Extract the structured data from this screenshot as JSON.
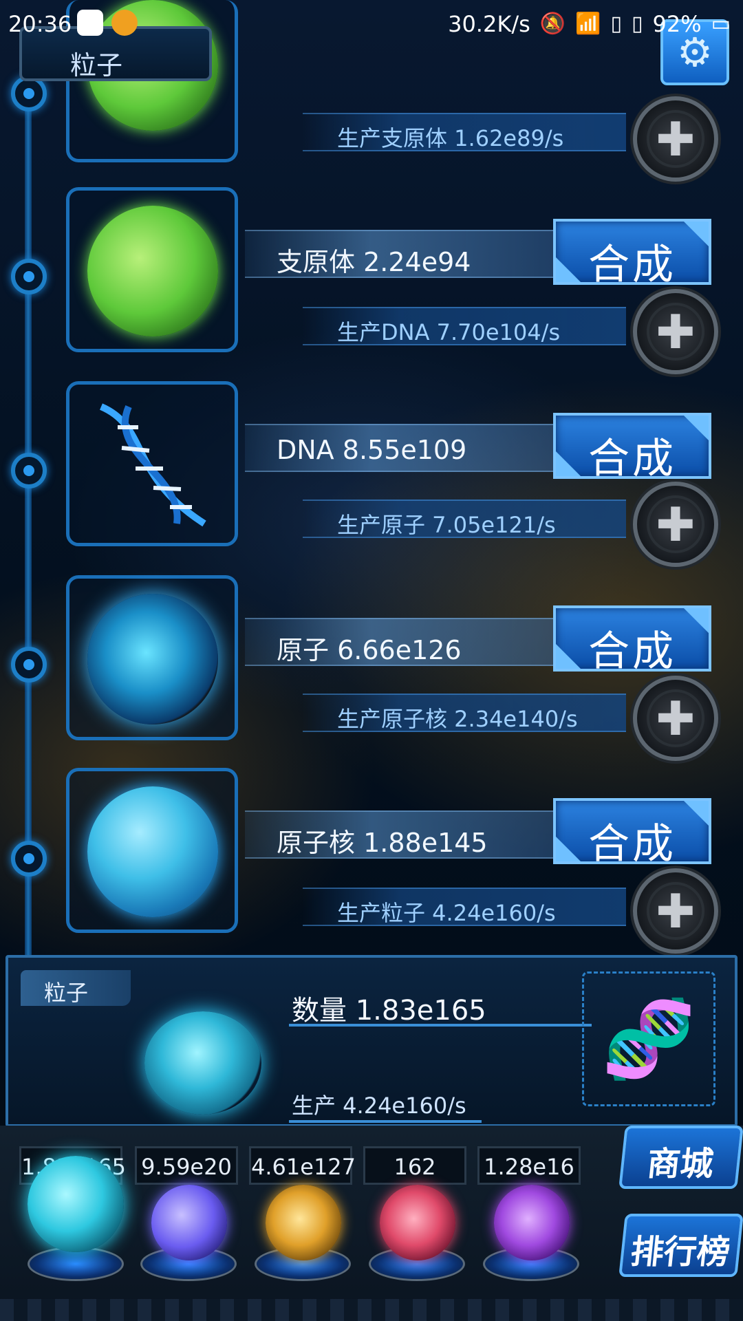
{
  "status_bar": {
    "time": "20:36",
    "speed": "30.2K/s",
    "battery": "92%",
    "icons": [
      "qq-icon",
      "app-icon",
      "mute-bell-icon",
      "wifi-icon",
      "sim-icon",
      "sim-icon",
      "battery-icon"
    ]
  },
  "header": {
    "title": "粒子",
    "settings_icon": "gear-icon"
  },
  "rows": [
    {
      "produce": "生产支原体 1.62e89/s"
    },
    {
      "name": "支原体 2.24e94",
      "synth": "合成",
      "produce": "生产DNA 7.70e104/s",
      "image": "mycoplasma-icon"
    },
    {
      "name": "DNA 8.55e109",
      "synth": "合成",
      "produce": "生产原子 7.05e121/s",
      "image": "dna-icon"
    },
    {
      "name": "原子 6.66e126",
      "synth": "合成",
      "produce": "生产原子核 2.34e140/s",
      "image": "atom-icon"
    },
    {
      "name": "原子核 1.88e145",
      "synth": "合成",
      "produce": "生产粒子 4.24e160/s",
      "image": "nucleus-icon"
    }
  ],
  "panel": {
    "tag": "粒子",
    "quantity": "数量 1.83e165",
    "production": "生产 4.24e160/s"
  },
  "resources": [
    {
      "value": "1.83e165",
      "icon": "particle-sphere-icon",
      "color": "#33c8e0"
    },
    {
      "value": "9.59e20",
      "icon": "lightning-sphere-icon",
      "color": "#7a6cff"
    },
    {
      "value": "4.61e127",
      "icon": "galaxy-sphere-icon",
      "color": "#e0a02a"
    },
    {
      "value": "162",
      "icon": "brain-sphere-icon",
      "color": "#e04a6a"
    },
    {
      "value": "1.28e16",
      "icon": "vortex-sphere-icon",
      "color": "#a04ae0"
    }
  ],
  "side_buttons": {
    "shop": "商城",
    "ranking": "排行榜"
  }
}
